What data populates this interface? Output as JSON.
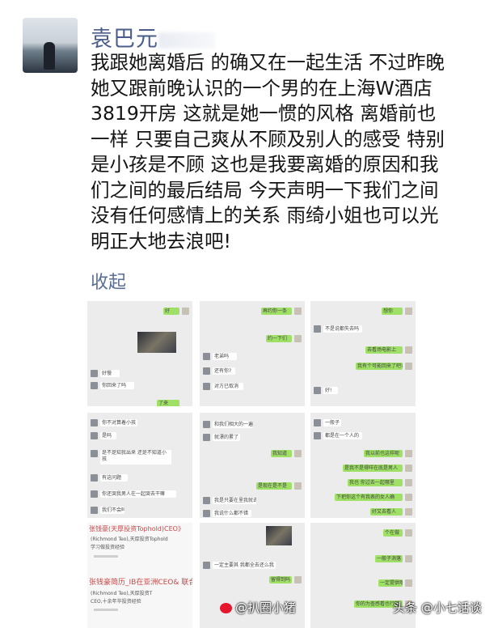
{
  "user": {
    "name": "袁巴元"
  },
  "post": {
    "lines": [
      "我跟她离婚后 的确又在一起生活 不过昨晚",
      "她又跟前晚认识的一个男的在上海W酒店",
      "3819开房 这就是她一惯的风格 离婚前也",
      "一样 只要自己爽从不顾及别人的感受 特别",
      "是小孩是不顾 这也是我要离婚的原因和我",
      "们之间的最后结局 今天声明一下我们之间",
      "没有任何感情上的关系 雨绮小姐也可以光",
      "明正大地去浪吧!"
    ],
    "collapse_label": "收起"
  },
  "screenshots": [
    {
      "bubbles": [
        "好",
        "好慢",
        "你回来了吗",
        "了来"
      ]
    },
    {
      "bubbles": [
        "再约你一条",
        "约一下们",
        "老弟吗",
        "还有你?",
        "对方已取消"
      ]
    },
    {
      "bubbles": [
        "想你",
        "不是说都失去吗",
        "去看场电影上",
        "我有个可能回来了吧?",
        "好!"
      ]
    },
    {
      "bubbles": [
        "你不对算着小孩",
        "是吗",
        "是不是知我出来 还是不知道小孩",
        "有这问题",
        "你还哭我男人在一起哭去干嘛",
        "我们不会吗"
      ]
    },
    {
      "bubbles": [
        "和我们相大的一遍",
        "就漂的累了",
        "我知道",
        "是现在是不是",
        "我是只要在里我就去",
        "我说什么都不错"
      ]
    },
    {
      "bubbles": [
        "一般子",
        "都是在一个人的",
        "我以前也这样呢",
        "是我不是得咩在底是男人",
        "我也 你过去一起哪里",
        "下把你这个有我表的女人确",
        "好又去看人"
      ]
    },
    {
      "feed_lines": [
        "张钱豪(天厚投资Tophold)CEO》",
        "(Richmond Teo),天厚投资Tophold",
        "学习做投资经验",
        "张钱豪简历_IB在亚洲CEO& 联合",
        "(Richmond Teo),天厚投资T",
        "CEO,十余年华投资经验"
      ]
    },
    {
      "bubbles": [
        "一定主要其 我都全去还么我",
        "留得到吗"
      ]
    },
    {
      "bubbles": [
        "个在做",
        "一般子消落",
        "一定提供哦",
        "你的为查感看也行啦"
      ]
    }
  ],
  "watermark": {
    "weibo": "@扒圈小猪",
    "toutiao": "头条 @小七话谈"
  }
}
